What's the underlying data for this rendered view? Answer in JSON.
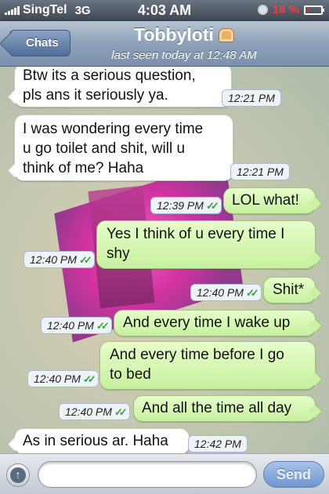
{
  "status_bar": {
    "carrier": "SingTel",
    "network": "3G",
    "time": "4:03 AM",
    "battery_percent": "16 %",
    "battery_level": 0.16,
    "battery_color": "#e02a2a"
  },
  "nav": {
    "back_label": "Chats",
    "contact_name": "Tobbyloti",
    "contact_icon": "bread-icon",
    "last_seen": "last seen today at 12:48 AM"
  },
  "messages": [
    {
      "direction": "in",
      "text": "Btw its a serious question,\npls ans it seriously ya.",
      "time": "12:21 PM"
    },
    {
      "direction": "in",
      "text": "I was wondering every time\nu go toilet and shit, will u\nthink of me? Haha",
      "time": "12:21 PM"
    },
    {
      "direction": "out",
      "text": "LOL what!",
      "time": "12:39 PM",
      "status": "delivered-read"
    },
    {
      "direction": "out",
      "text": "Yes I think of u every time I\nshy",
      "time": "12:40 PM",
      "status": "delivered-read"
    },
    {
      "direction": "out",
      "text": "Shit*",
      "time": "12:40 PM",
      "status": "delivered-read"
    },
    {
      "direction": "out",
      "text": "And every time I wake up",
      "time": "12:40 PM",
      "status": "delivered-read"
    },
    {
      "direction": "out",
      "text": "And every time before I go\nto bed",
      "time": "12:40 PM",
      "status": "delivered-read"
    },
    {
      "direction": "out",
      "text": "And all the time all day",
      "time": "12:40 PM",
      "status": "delivered-read"
    },
    {
      "direction": "in",
      "text": "As in serious ar. Haha",
      "time": "12:42 PM"
    }
  ],
  "ticks_glyph": "✓✓",
  "input_bar": {
    "attach_icon": "arrow-up-icon",
    "attach_glyph": "↑",
    "placeholder": "",
    "send_label": "Send"
  },
  "colors": {
    "outgoing_bubble": "#d4f5b0",
    "incoming_bubble": "#ffffff",
    "read_ticks": "#39a43a",
    "nav_bar": "#8ea1b8"
  }
}
